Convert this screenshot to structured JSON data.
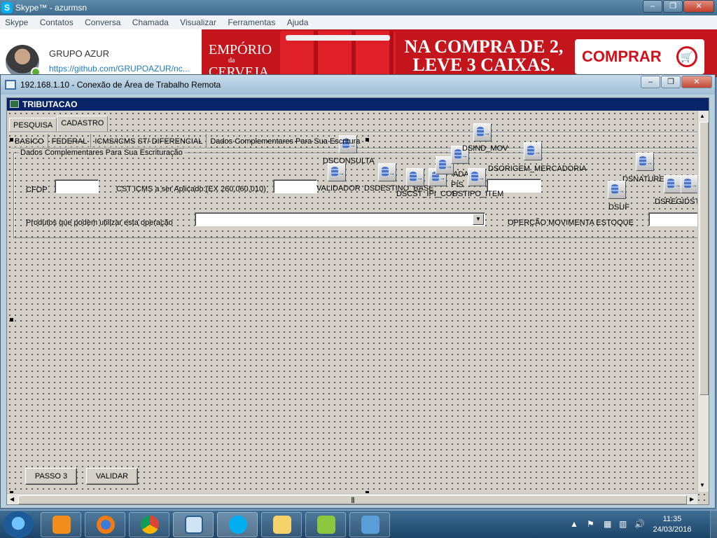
{
  "skype": {
    "title": "Skype™ - azurmsn",
    "menu": [
      "Skype",
      "Contatos",
      "Conversa",
      "Chamada",
      "Visualizar",
      "Ferramentas",
      "Ajuda"
    ],
    "profile": {
      "name": "GRUPO AZUR",
      "url": "https://github.com/GRUPOAZUR/nc..."
    },
    "ad": {
      "brand_line1": "EMPÓRIO",
      "brand_line2": "da",
      "brand_line3": "CERVEJA",
      "headline_line1": "NA COMPRA DE 2,",
      "headline_line2": "LEVE 3 CAIXAS.",
      "button": "COMPRAR",
      "colors": {
        "background": "#c4151c",
        "button_text": "#d0111b"
      }
    },
    "window_buttons": [
      "–",
      "❐",
      "✕"
    ]
  },
  "rdp": {
    "title": "192.168.1.10 - Conexão de Área de Trabalho Remota",
    "window_buttons": [
      "–",
      "❐",
      "✕"
    ]
  },
  "form": {
    "title": "TRIBUTACAO",
    "main_tabs": [
      "PESQUISA",
      "CADASTRO"
    ],
    "active_main_tab": "CADASTRO",
    "sub_tabs": [
      "BASICO",
      "FEDERAL",
      "ICMS/ICMS ST/ DIFERENCIAL",
      "Dados Complementares Para Sua Escrituração"
    ],
    "active_sub_tab": "Dados Complementares Para Sua Escrituração",
    "sub_tab_display_text": "Dados Complementares Para Sua Escritura",
    "group_label": "Dados Complementares Para Sua Escrituração",
    "fields": {
      "cfop_label": "CFOP",
      "cfop_value": "",
      "cst_label": "CST ICMS a ser Aplicado:(EX 260,060,010)",
      "cst_value": "",
      "produtos_label": "Produtos que podem utilizar esta operação",
      "produtos_value": "",
      "movimenta_label": "OPERÇÃO MOVIMENTA ESTOQUE",
      "movimenta_value": "",
      "extra_value": ""
    },
    "datasources": [
      "DSCONSULTA",
      "VALIDADOR",
      "DSDESTINO_BASE",
      "DSCST_IPI_COF",
      "ADA",
      "PIS",
      "DSIND_MOV",
      "DSTIPO_ITEM",
      "DSORIGEM_MERCADORIA",
      "DSNATUREZA",
      "DSUF",
      "DSREGIDSTV"
    ],
    "buttons": {
      "passo3": "PASSO 3",
      "validar": "VALIDAR"
    },
    "scroll_grip": "|||"
  },
  "taskbar": {
    "apps": [
      "Windows Media Player",
      "Firefox",
      "Chrome",
      "Remote Desktop",
      "Skype",
      "Windows Explorer",
      "Notepad++",
      "Image Viewer"
    ],
    "tray_icons": [
      "up-arrow",
      "flag",
      "network",
      "speaker"
    ],
    "time": "11:35",
    "date": "24/03/2016"
  }
}
